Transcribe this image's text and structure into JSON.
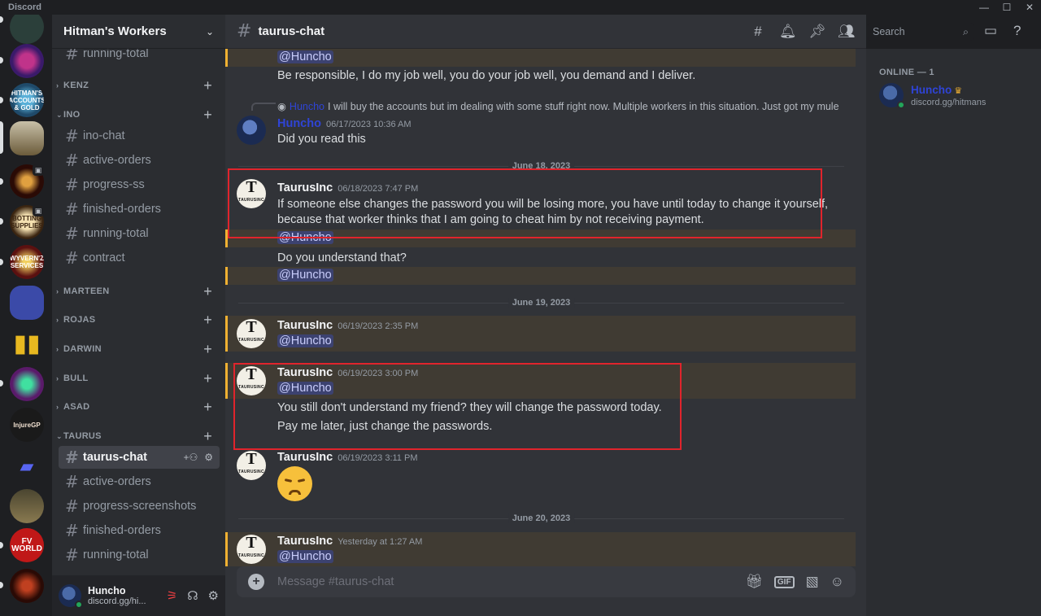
{
  "window": {
    "app_name": "Discord",
    "min": "—",
    "max": "☐",
    "close": "✕"
  },
  "guild": {
    "name": "Hitman's Workers",
    "chevron": "⌄"
  },
  "servers": [
    {
      "label": "",
      "color": "#2b3f3a"
    },
    {
      "label": "",
      "color": "#6b1a5f"
    },
    {
      "label": "HITMAN'S ACCOUNTS & GOLD",
      "color": "#1f5a7a"
    },
    {
      "label": "",
      "color": "#8a7a5a"
    },
    {
      "label": "",
      "color": "#7a2a10"
    },
    {
      "label": "BOTTING SUPPLIES",
      "color": "#c9a25a"
    },
    {
      "label": "WYVERN'Z SERVICES",
      "color": "#3a1e1e"
    },
    {
      "label": "",
      "color": "#3b4aa8"
    },
    {
      "label": "",
      "color": "#1e1f22"
    },
    {
      "label": "",
      "color": "#3a1a3a"
    },
    {
      "label": "InjureGP",
      "color": "#1a1a1a"
    },
    {
      "label": "",
      "color": "#313338"
    },
    {
      "label": "",
      "color": "#6a6040"
    },
    {
      "label": "FV WORLD",
      "color": "#7a1010"
    },
    {
      "label": "",
      "color": "#3a1510"
    }
  ],
  "channels": {
    "top": [
      "running-total"
    ],
    "ino_channels": [
      "ino-chat",
      "active-orders",
      "progress-ss",
      "finished-orders",
      "running-total",
      "contract"
    ],
    "categories": [
      "KENZ",
      "INO",
      "MARTEEN",
      "ROJAS",
      "DARWIN",
      "BULL",
      "ASAD",
      "TAURUS"
    ],
    "taurus_channels": [
      "taurus-chat",
      "active-orders",
      "progress-screenshots",
      "finished-orders",
      "running-total"
    ]
  },
  "user_panel": {
    "name": "Huncho",
    "status": "discord.gg/hi..."
  },
  "header": {
    "channel": "taurus-chat",
    "search_placeholder": "Search"
  },
  "messages": {
    "m1_mention": "@Huncho",
    "m1_text": "Be responsible, I do my job well, you do your job well, you demand and I deliver.",
    "reply_name": "Huncho",
    "reply_text": "I will buy the accounts but im dealing with some stuff right now. Multiple workers in this situation. Just got my mule",
    "m2_author": "Huncho",
    "m2_ts": "06/17/2023 10:36 AM",
    "m2_text": "Did you read this",
    "div1": "June 18, 2023",
    "m3_author": "TaurusInc",
    "m3_ts": "06/18/2023 7:47 PM",
    "m3_line1": "If someone else changes the password you will be losing more, you have until today to change it yourself,",
    "m3_line2": "because that worker thinks that I am going to cheat him by not receiving payment.",
    "m3_mention": "@Huncho",
    "m3_line3": "Do you understand that?",
    "m3_mention2": "@Huncho",
    "div2": "June 19, 2023",
    "m4_author": "TaurusInc",
    "m4_ts": "06/19/2023 2:35 PM",
    "m4_mention": "@Huncho",
    "m5_author": "TaurusInc",
    "m5_ts": "06/19/2023 3:00 PM",
    "m5_mention": "@Huncho",
    "m5_line1": "You still don't understand my friend? they will change the password today.",
    "m5_line2": "Pay me later, just change the passwords.",
    "m6_author": "TaurusInc",
    "m6_ts": "06/19/2023 3:11 PM",
    "div3": "June 20, 2023",
    "m7_author": "TaurusInc",
    "m7_ts": "Yesterday at 1:27 AM",
    "m7_mention": "@Huncho"
  },
  "avatar_letter": "T",
  "avatar_sub": "TAURUSINC",
  "composer": {
    "placeholder": "Message #taurus-chat",
    "gif": "GIF"
  },
  "members": {
    "category": "ONLINE — 1",
    "name": "Huncho",
    "sub": "discord.gg/hitmans"
  },
  "colors": {
    "highlight": "#403b33",
    "accent": "#f0b132",
    "redbox": "#e0242c"
  }
}
